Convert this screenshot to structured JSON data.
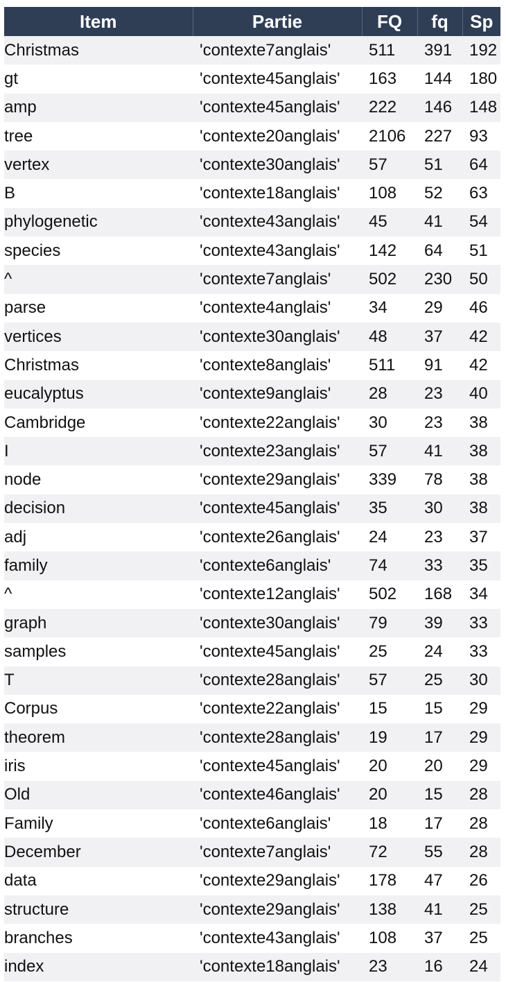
{
  "table": {
    "headers": [
      "Item",
      "Partie",
      "FQ",
      "fq",
      "Sp"
    ],
    "rows": [
      [
        "Christmas",
        "'contexte7anglais'",
        "511",
        "391",
        "192"
      ],
      [
        "gt",
        "'contexte45anglais'",
        "163",
        "144",
        "180"
      ],
      [
        "amp",
        "'contexte45anglais'",
        "222",
        "146",
        "148"
      ],
      [
        "tree",
        "'contexte20anglais'",
        "2106",
        "227",
        "93"
      ],
      [
        "vertex",
        "'contexte30anglais'",
        "57",
        "51",
        "64"
      ],
      [
        "B",
        "'contexte18anglais'",
        "108",
        "52",
        "63"
      ],
      [
        "phylogenetic",
        "'contexte43anglais'",
        "45",
        "41",
        "54"
      ],
      [
        "species",
        "'contexte43anglais'",
        "142",
        "64",
        "51"
      ],
      [
        "^",
        "'contexte7anglais'",
        "502",
        "230",
        "50"
      ],
      [
        "parse",
        "'contexte4anglais'",
        "34",
        "29",
        "46"
      ],
      [
        "vertices",
        "'contexte30anglais'",
        "48",
        "37",
        "42"
      ],
      [
        "Christmas",
        "'contexte8anglais'",
        "511",
        "91",
        "42"
      ],
      [
        "eucalyptus",
        "'contexte9anglais'",
        "28",
        "23",
        "40"
      ],
      [
        "Cambridge",
        "'contexte22anglais'",
        "30",
        "23",
        "38"
      ],
      [
        "I",
        "'contexte23anglais'",
        "57",
        "41",
        "38"
      ],
      [
        "node",
        "'contexte29anglais'",
        "339",
        "78",
        "38"
      ],
      [
        "decision",
        "'contexte45anglais'",
        "35",
        "30",
        "38"
      ],
      [
        "adj",
        "'contexte26anglais'",
        "24",
        "23",
        "37"
      ],
      [
        "family",
        "'contexte6anglais'",
        "74",
        "33",
        "35"
      ],
      [
        "^",
        "'contexte12anglais'",
        "502",
        "168",
        "34"
      ],
      [
        "graph",
        "'contexte30anglais'",
        "79",
        "39",
        "33"
      ],
      [
        "samples",
        "'contexte45anglais'",
        "25",
        "24",
        "33"
      ],
      [
        "T",
        "'contexte28anglais'",
        "57",
        "25",
        "30"
      ],
      [
        "Corpus",
        "'contexte22anglais'",
        "15",
        "15",
        "29"
      ],
      [
        "theorem",
        "'contexte28anglais'",
        "19",
        "17",
        "29"
      ],
      [
        "iris",
        "'contexte45anglais'",
        "20",
        "20",
        "29"
      ],
      [
        "Old",
        "'contexte46anglais'",
        "20",
        "15",
        "28"
      ],
      [
        "Family",
        "'contexte6anglais'",
        "18",
        "17",
        "28"
      ],
      [
        "December",
        "'contexte7anglais'",
        "72",
        "55",
        "28"
      ],
      [
        "data",
        "'contexte29anglais'",
        "178",
        "47",
        "26"
      ],
      [
        "structure",
        "'contexte29anglais'",
        "138",
        "41",
        "25"
      ],
      [
        "branches",
        "'contexte43anglais'",
        "108",
        "37",
        "25"
      ],
      [
        "index",
        "'contexte18anglais'",
        "23",
        "16",
        "24"
      ]
    ]
  },
  "colors": {
    "header_bg": "#2f3e55",
    "header_text": "#ffffff",
    "row_stripe": "#f1f1f3"
  }
}
